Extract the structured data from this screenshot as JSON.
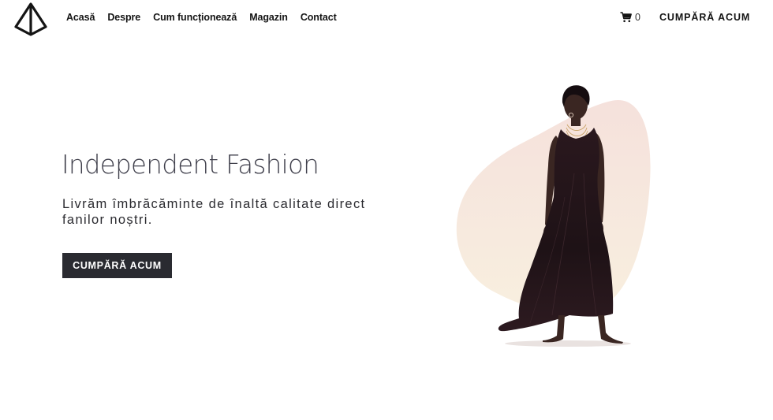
{
  "header": {
    "logo_alt": "logo",
    "nav": [
      {
        "label": "Acasă"
      },
      {
        "label": "Despre"
      },
      {
        "label": "Cum funcționează"
      },
      {
        "label": "Magazin"
      },
      {
        "label": "Contact"
      }
    ],
    "cart_count": "0",
    "cta_label": "CUMPĂRĂ ACUM"
  },
  "hero": {
    "title": "Independent Fashion",
    "subtitle": "Livrăm îmbrăcăminte de înaltă calitate direct fanilor noștri.",
    "button_label": "CUMPĂRĂ ACUM"
  },
  "colors": {
    "text_dark": "#141414",
    "button_bg": "#2a2b31",
    "blob_top": "#f5e1dc",
    "blob_bottom": "#f8efdf",
    "dress": "#221418"
  },
  "icons": {
    "logo": "diamond-logo-icon",
    "cart": "shopping-cart-icon"
  }
}
